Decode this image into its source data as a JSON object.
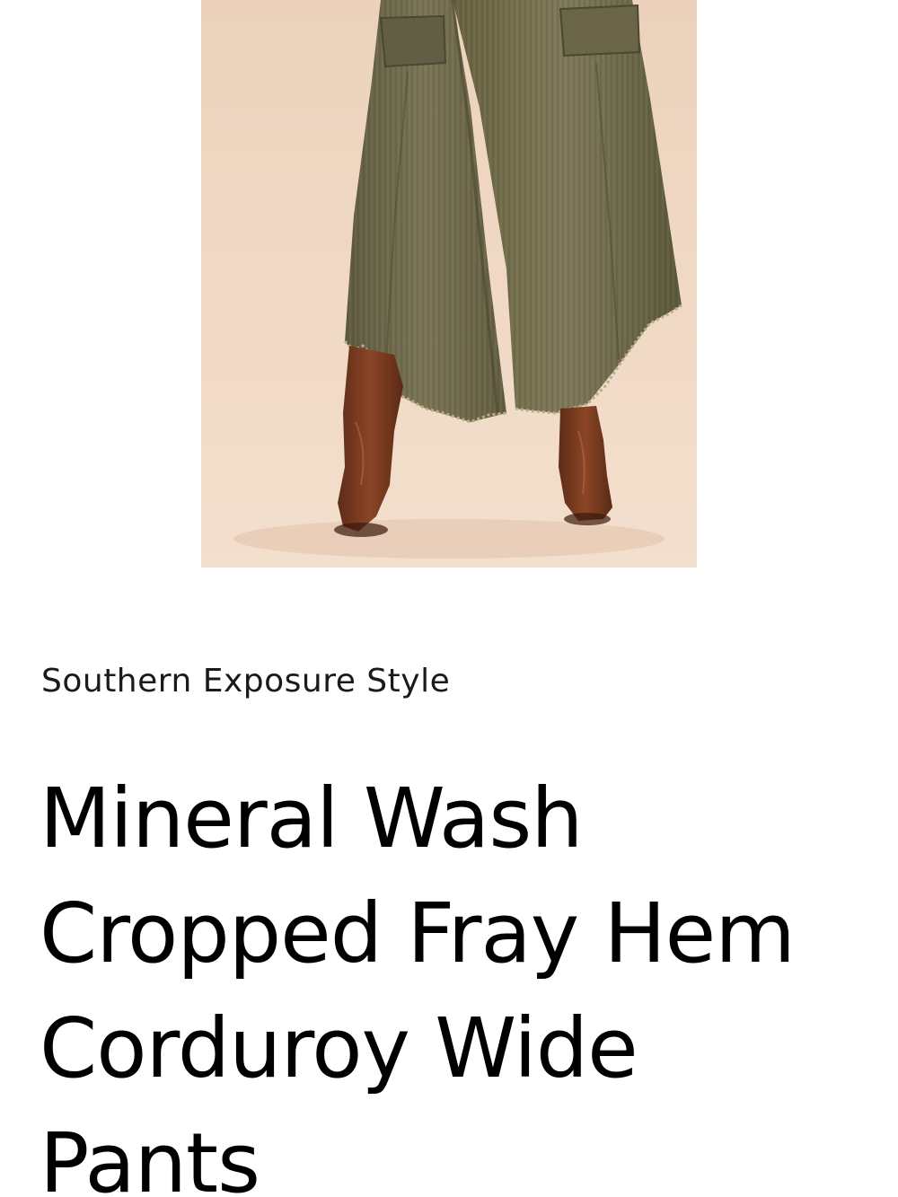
{
  "product": {
    "image_subject": "olive mineral wash corduroy wide leg pants with frayed hem and brown western boots",
    "brand": "Southern Exposure Style",
    "title": "Mineral Wash Cropped Fray Hem Corduroy Wide Pants"
  },
  "colors": {
    "background": "#ffffff",
    "image_backdrop": "#f0d9c4",
    "pants": "#6f6a4c",
    "boots": "#7a3d22",
    "text": "#000000"
  }
}
